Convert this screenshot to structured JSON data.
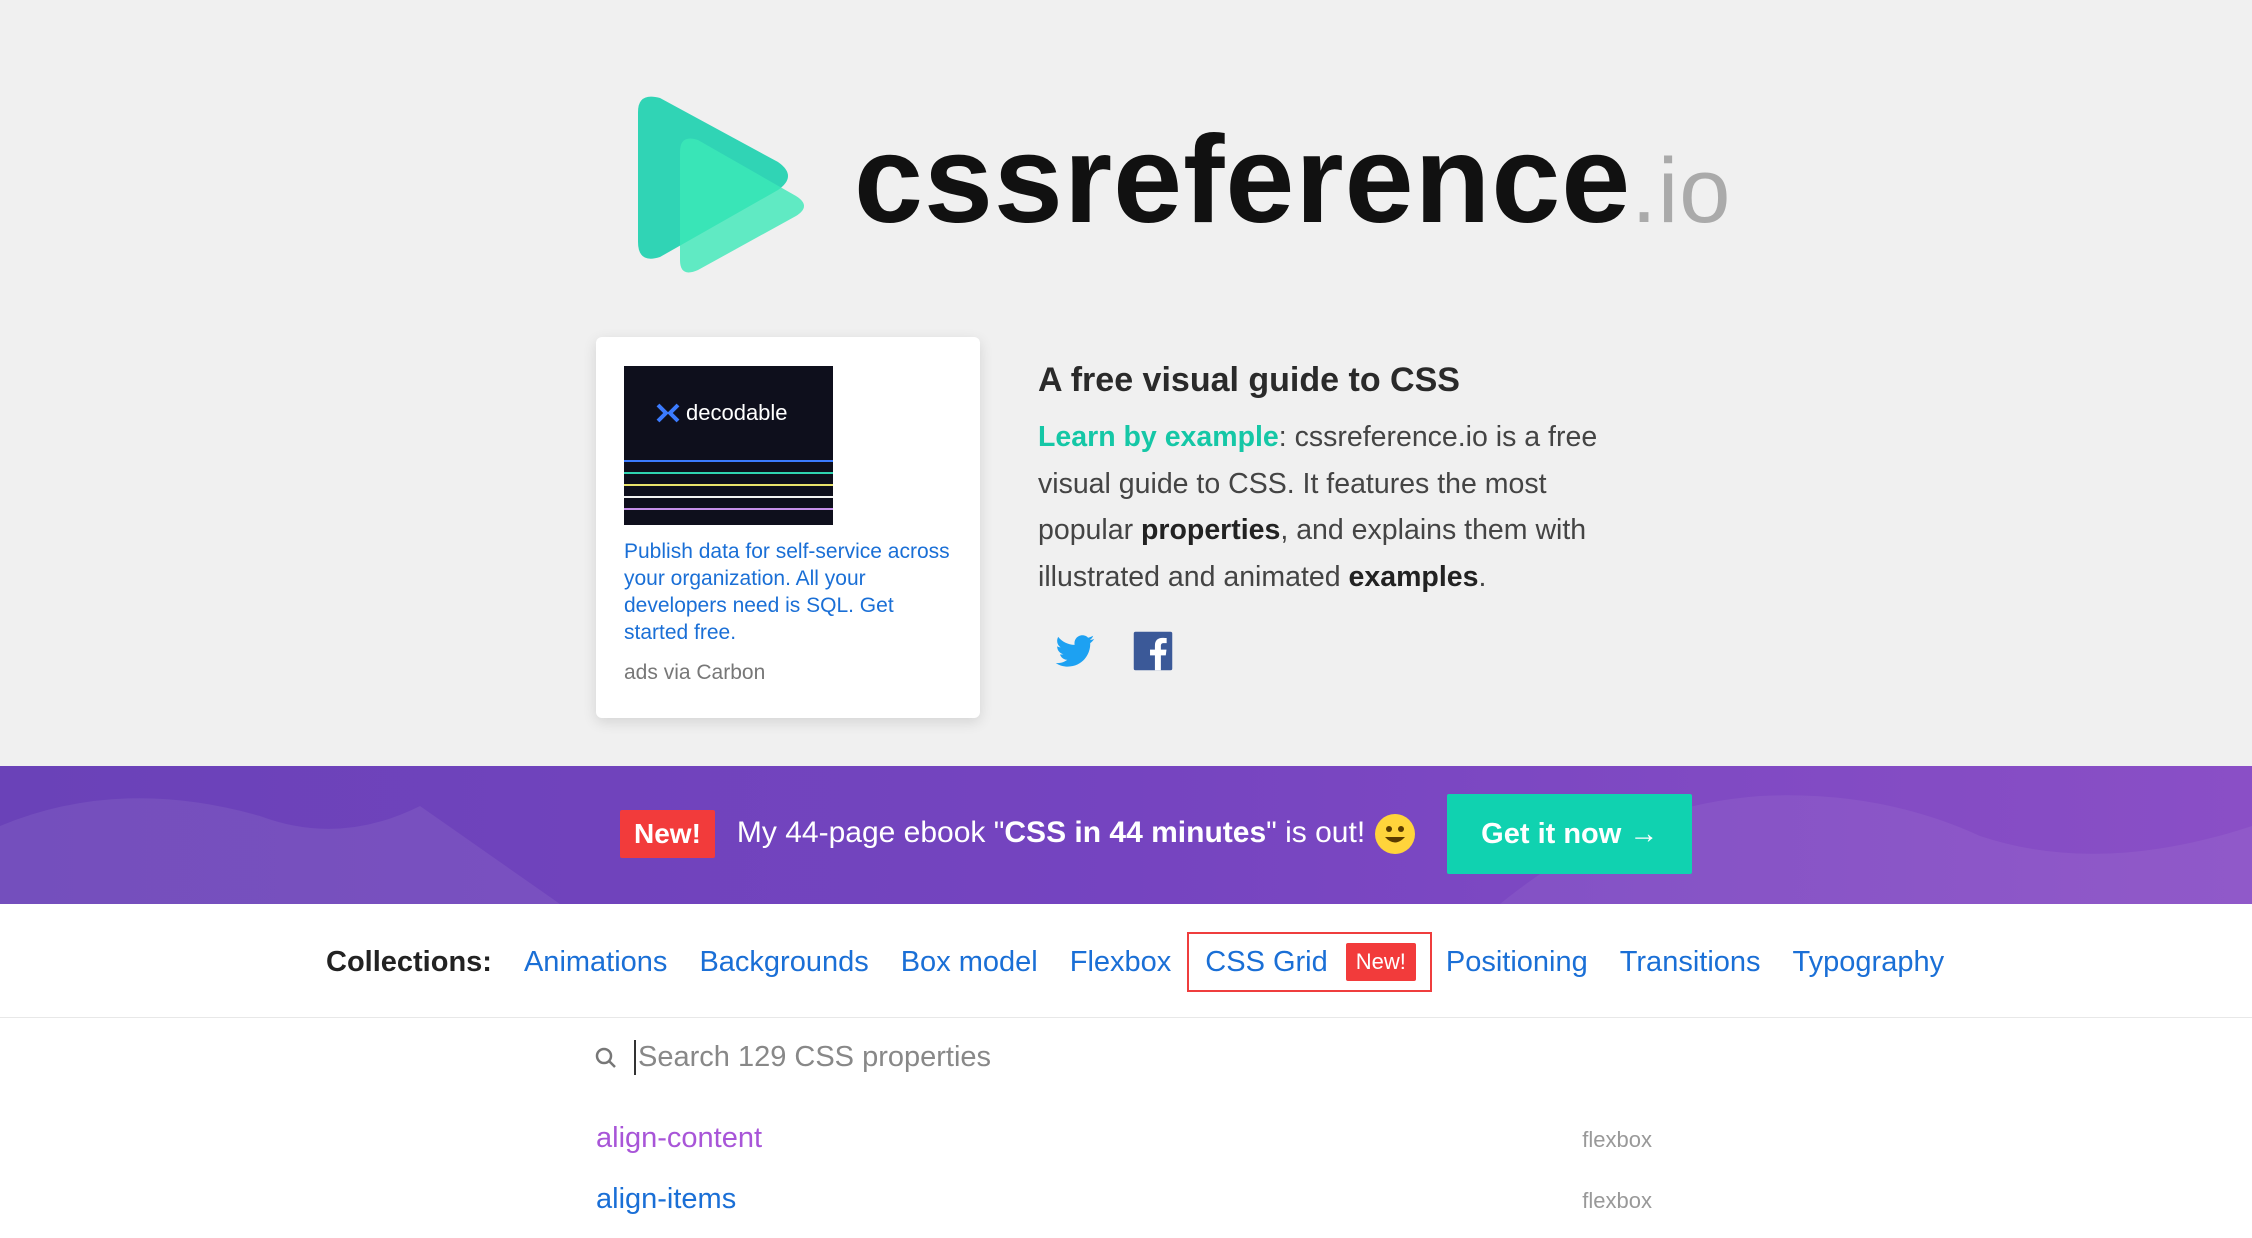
{
  "logo": {
    "main": "cssreference",
    "tld": ".io"
  },
  "ad": {
    "brand": "decodable",
    "text": "Publish data for self-service across your organization. All your developers need is SQL. Get started free.",
    "via": "ads via Carbon"
  },
  "intro": {
    "title": "A free visual guide to CSS",
    "lead": "Learn by example",
    "part1": ": cssreference.io is a free visual guide to CSS. It features the most popular ",
    "bold1": "properties",
    "part2": ", and explains them with illustrated and animated ",
    "bold2": "examples",
    "part3": "."
  },
  "social": {
    "twitter_icon": "twitter-icon",
    "facebook_icon": "facebook-icon"
  },
  "banner": {
    "badge": "New!",
    "text_before": "My 44-page ebook \"",
    "ebook_title": "CSS in 44 minutes",
    "text_after": "\" is out!",
    "button": "Get it now →"
  },
  "collections": {
    "label": "Collections:",
    "items": [
      "Animations",
      "Backgrounds",
      "Box model",
      "Flexbox",
      "CSS Grid",
      "Positioning",
      "Transitions",
      "Typography"
    ],
    "grid_badge": "New!"
  },
  "search": {
    "placeholder": "Search 129 CSS properties"
  },
  "properties": [
    {
      "name": "align-content",
      "category": "flexbox",
      "color": "#a855d8"
    },
    {
      "name": "align-items",
      "category": "flexbox",
      "color": "#1a6fd6"
    }
  ],
  "colors": {
    "accent_teal": "#10d2b0",
    "banner_purple": "#6f44bd",
    "link_blue": "#1a6fd6",
    "badge_red": "#f23b3b"
  }
}
